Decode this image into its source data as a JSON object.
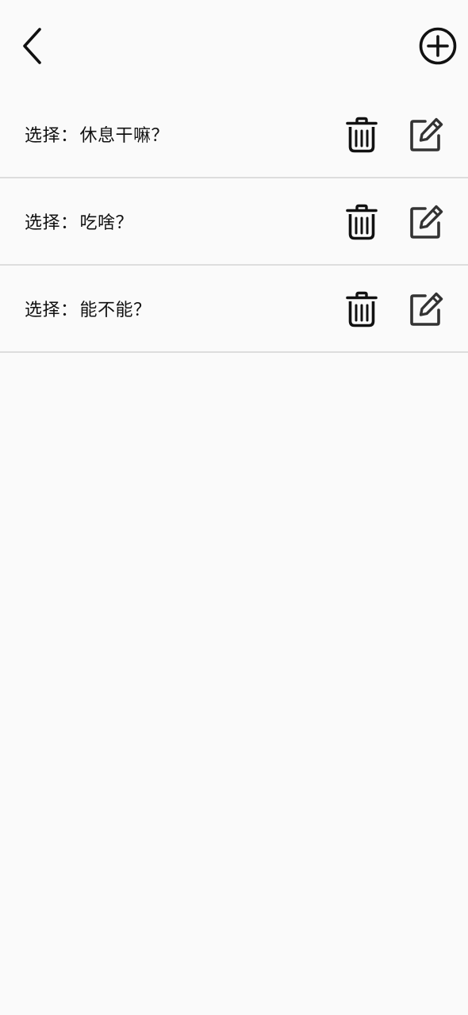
{
  "header": {
    "back_icon": "chevron-left-icon",
    "add_icon": "plus-circle-icon"
  },
  "items": [
    {
      "prefix": "选择：",
      "title": "休息干嘛？"
    },
    {
      "prefix": "选择：",
      "title": "吃啥？"
    },
    {
      "prefix": "选择：",
      "title": "能不能？"
    }
  ],
  "icons": {
    "delete": "trash-icon",
    "edit": "edit-icon"
  },
  "colors": {
    "background": "#fafafa",
    "divider": "#dddddd",
    "text": "#111111",
    "icon": "#111111"
  }
}
